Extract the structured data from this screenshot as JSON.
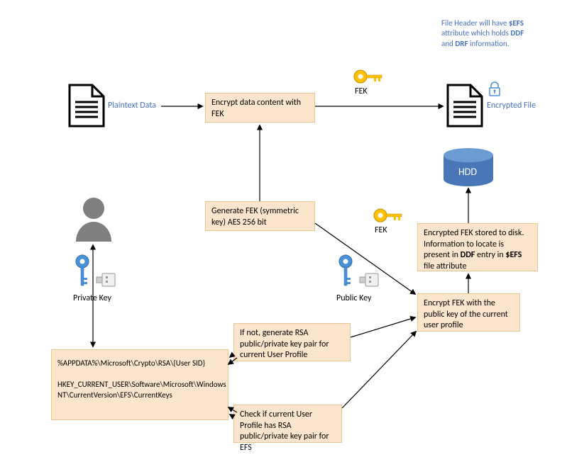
{
  "header": {
    "line1a": "File Header will have ",
    "efs": "$EFS",
    "line1b": " attribute which holds ",
    "ddf": "DDF",
    "and": " and ",
    "drf": "DRF",
    "line2": " information."
  },
  "labels": {
    "plaintext": "Plaintext Data",
    "encrypted_file": "Encrypted File",
    "fek_top": "FEK",
    "fek_mid": "FEK",
    "private_key": "Private Key",
    "public_key": "Public Key",
    "hdd": "HDD"
  },
  "boxes": {
    "encrypt_data": "Encrypt data content with FEK",
    "generate_fek": "Generate FEK (symmetric key) AES 256 bit",
    "encrypted_fek_a": "Encrypted FEK stored to disk. Information to locate is present in ",
    "encrypted_fek_b": " entry in ",
    "encrypted_fek_c": " file attribute",
    "encrypt_fek_pub": "Encrypt FEK with the public key of the current user profile",
    "gen_rsa": "If not, generate RSA public/private key pair for current User Profile",
    "check_rsa": "Check if current User Profile has RSA public/private key pair for EFS",
    "paths_line1": "%APPDATA%\\Microsoft\\Crypto\\RSA\\{User SID}",
    "paths_line2": "HKEY_CURRENT_USER\\Software\\Microsoft\\Windows NT\\CurrentVersion\\EFS\\CurrentKeys"
  }
}
